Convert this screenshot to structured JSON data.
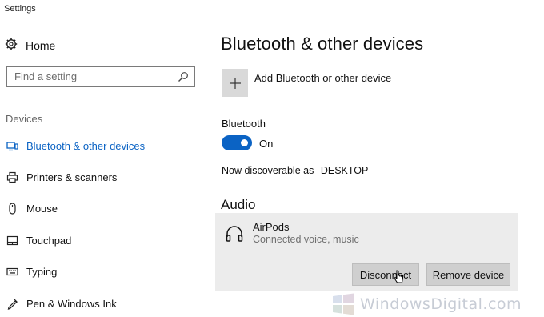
{
  "window": {
    "title": "Settings"
  },
  "sidebar": {
    "home_label": "Home",
    "search_placeholder": "Find a setting",
    "section_label": "Devices",
    "items": [
      {
        "label": "Bluetooth & other devices",
        "icon": "bluetooth-devices-icon",
        "selected": true
      },
      {
        "label": "Printers & scanners",
        "icon": "printer-icon",
        "selected": false
      },
      {
        "label": "Mouse",
        "icon": "mouse-icon",
        "selected": false
      },
      {
        "label": "Touchpad",
        "icon": "touchpad-icon",
        "selected": false
      },
      {
        "label": "Typing",
        "icon": "keyboard-icon",
        "selected": false
      },
      {
        "label": "Pen & Windows Ink",
        "icon": "pen-icon",
        "selected": false
      }
    ]
  },
  "main": {
    "title": "Bluetooth & other devices",
    "add_device_label": "Add Bluetooth or other device",
    "bluetooth_label": "Bluetooth",
    "toggle_state": "On",
    "discoverable_text": "Now discoverable as",
    "device_name": "DESKTOP",
    "audio_heading": "Audio",
    "audio_device": {
      "name": "AirPods",
      "status": "Connected voice, music",
      "disconnect_label": "Disconnect",
      "remove_label": "Remove device"
    }
  },
  "watermark": {
    "text": "WindowsDigital.com"
  },
  "colors": {
    "accent": "#0b63c4",
    "card_bg": "#ececec",
    "button_bg": "#cfcfcf"
  }
}
